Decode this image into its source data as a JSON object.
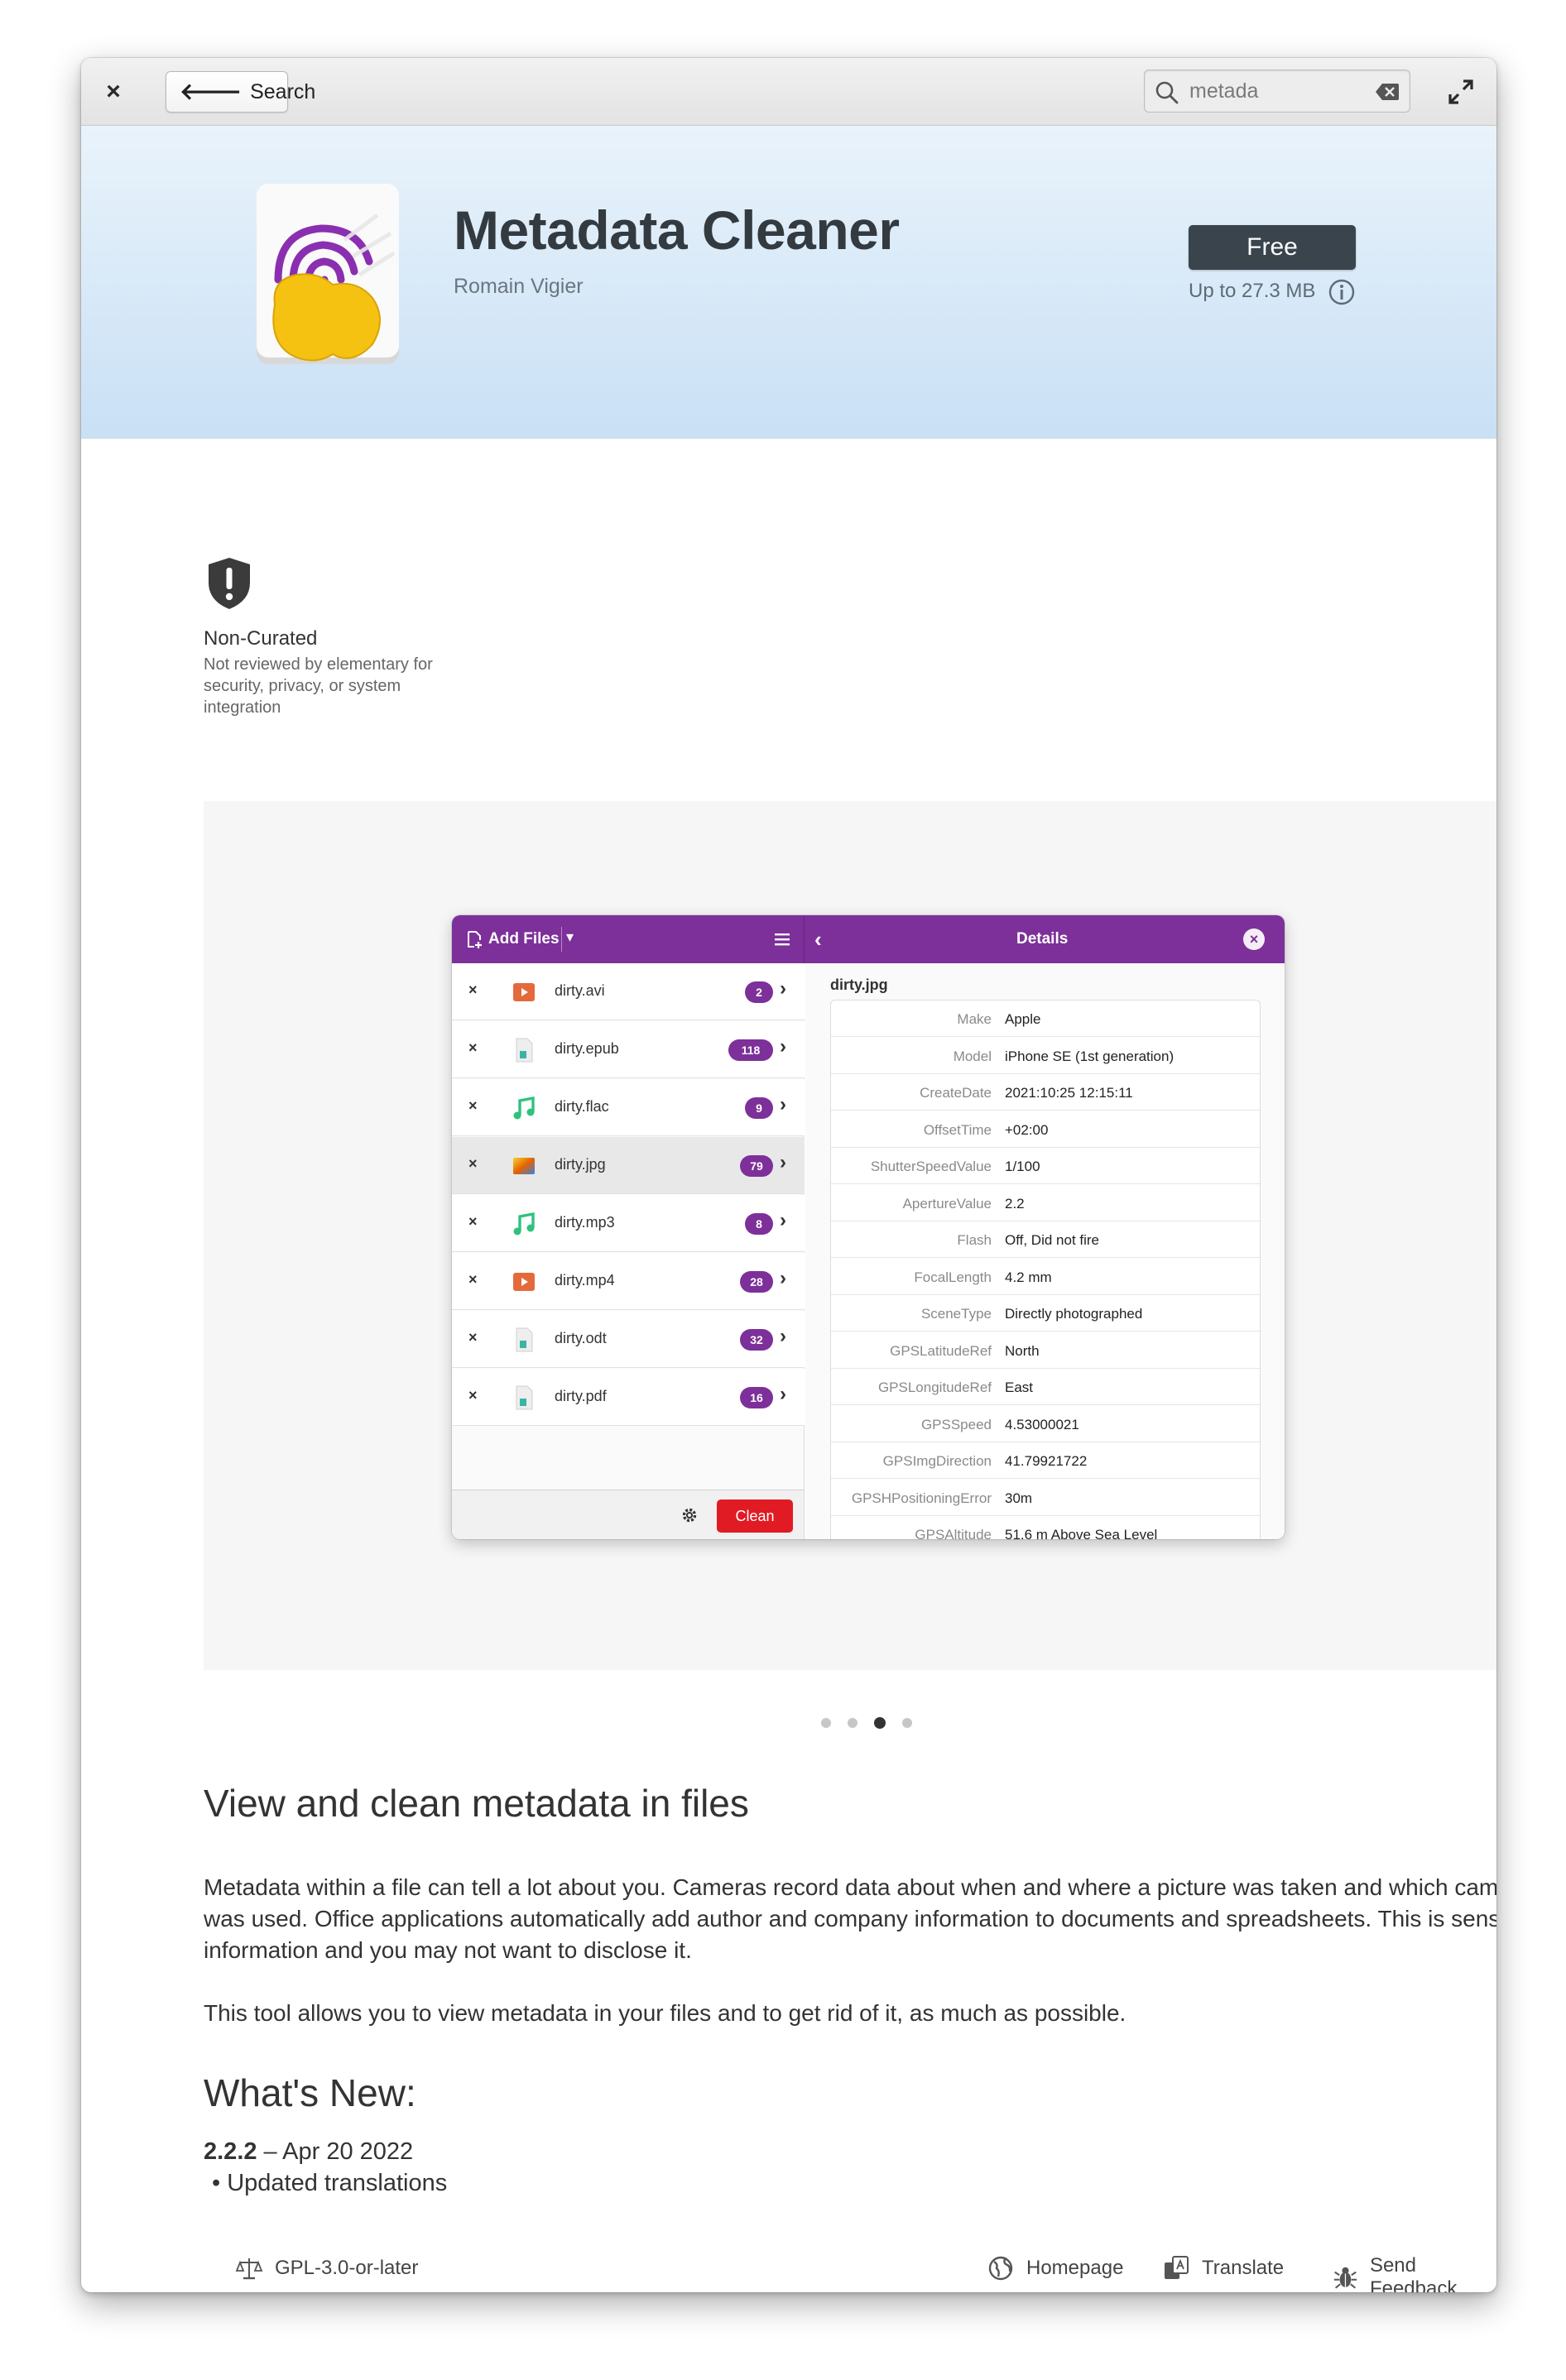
{
  "headerbar": {
    "close_glyph": "×",
    "back_label": "Search",
    "search_value": "metada",
    "icons": [
      "close-icon",
      "back-arrow-icon",
      "search-icon",
      "clear-icon",
      "expand-icon"
    ]
  },
  "app": {
    "title": "Metadata Cleaner",
    "developer": "Romain Vigier",
    "install_label": "Free",
    "size_label": "Up to 27.3 MB"
  },
  "curation": {
    "title": "Non-Curated",
    "description": "Not reviewed by elementary for security, privacy, or system integration"
  },
  "screenshot": {
    "add_files_label": "Add Files",
    "details_title": "Details",
    "clean_label": "Clean",
    "files": [
      {
        "name": "dirty.avi",
        "count": "2",
        "type": "video"
      },
      {
        "name": "dirty.epub",
        "count": "118",
        "type": "doc"
      },
      {
        "name": "dirty.flac",
        "count": "9",
        "type": "audio"
      },
      {
        "name": "dirty.jpg",
        "count": "79",
        "type": "image",
        "selected": true
      },
      {
        "name": "dirty.mp3",
        "count": "8",
        "type": "audio"
      },
      {
        "name": "dirty.mp4",
        "count": "28",
        "type": "video"
      },
      {
        "name": "dirty.odt",
        "count": "32",
        "type": "doc"
      },
      {
        "name": "dirty.pdf",
        "count": "16",
        "type": "doc"
      }
    ],
    "detail_file": "dirty.jpg",
    "details": [
      {
        "key": "Make",
        "value": "Apple"
      },
      {
        "key": "Model",
        "value": "iPhone SE (1st generation)"
      },
      {
        "key": "CreateDate",
        "value": "2021:10:25 12:15:11"
      },
      {
        "key": "OffsetTime",
        "value": "+02:00"
      },
      {
        "key": "ShutterSpeedValue",
        "value": "1/100"
      },
      {
        "key": "ApertureValue",
        "value": "2.2"
      },
      {
        "key": "Flash",
        "value": "Off, Did not fire"
      },
      {
        "key": "FocalLength",
        "value": "4.2 mm"
      },
      {
        "key": "SceneType",
        "value": "Directly photographed"
      },
      {
        "key": "GPSLatitudeRef",
        "value": "North"
      },
      {
        "key": "GPSLongitudeRef",
        "value": "East"
      },
      {
        "key": "GPSSpeed",
        "value": "4.53000021"
      },
      {
        "key": "GPSImgDirection",
        "value": "41.79921722"
      },
      {
        "key": "GPSHPositioningError",
        "value": "30m"
      },
      {
        "key": "GPSAltitude",
        "value": "51.6 m Above Sea Level"
      }
    ]
  },
  "carousel": {
    "count": 4,
    "active_index": 2
  },
  "description": {
    "title": "View and clean metadata in files",
    "paragraph1": "Metadata within a file can tell a lot about you. Cameras record data about when and where a picture was taken and which camera was used. Office applications automatically add author and company information to documents and spreadsheets. This is sensitive information and you may not want to disclose it.",
    "paragraph2": "This tool allows you to view metadata in your files and to get rid of it, as much as possible."
  },
  "whats_new": {
    "title": "What's New:",
    "version": "2.2.2",
    "separator": " – ",
    "date": "Apr 20 2022",
    "note": "• Updated translations"
  },
  "footer": {
    "license": "GPL-3.0-or-later",
    "homepage": "Homepage",
    "translate": "Translate",
    "feedback": "Send Feedback"
  },
  "colors": {
    "accent": "#7d3099",
    "install_button": "#3a444d",
    "banner_top": "#e9f3fb",
    "banner_bottom": "#c9e0f5",
    "clean_button": "#e01b24"
  }
}
